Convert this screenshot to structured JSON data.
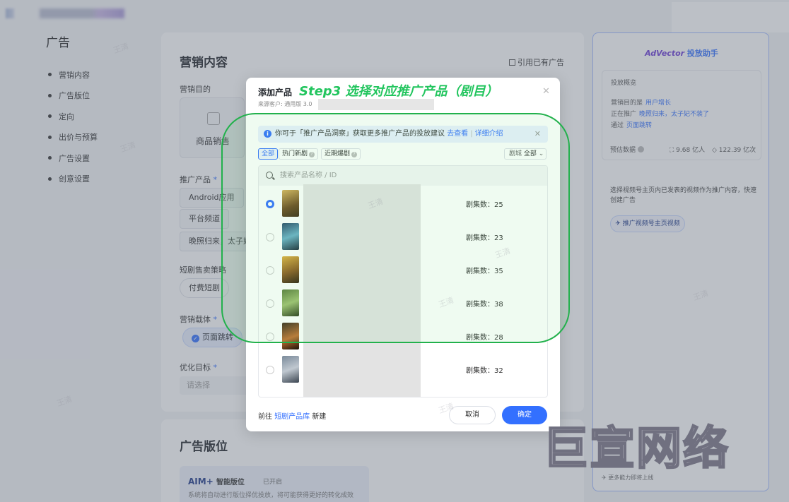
{
  "nav": {
    "title": "广告",
    "items": [
      "营销内容",
      "广告版位",
      "定向",
      "出价与预算",
      "广告设置",
      "创意设置"
    ]
  },
  "main": {
    "title": "营销内容",
    "cite_label": "引用已有广告",
    "goal_label": "营销目的",
    "goal_option": "商品销售",
    "product_label": "推广产品",
    "product_types": [
      "Android应用",
      "平台频道"
    ],
    "selected_product_text": "晚照归来，太子妃",
    "strategy_label": "短剧售卖策略",
    "strategy_option": "付费短剧",
    "carrier_label": "营销载体",
    "carrier_option": "页面跳转",
    "opt_label": "优化目标",
    "opt_placeholder": "请选择"
  },
  "position": {
    "title": "广告版位",
    "aim_brand": "AIM+",
    "aim_title": "智能版位",
    "aim_status": "已开启",
    "aim_desc": "系统将自动进行版位择优投放，将可能获得更好的转化成效"
  },
  "assistant": {
    "brand": "AdVector",
    "title": "投放助手",
    "overview": "投放概览",
    "goal_prefix": "营销目的是",
    "goal_value": "用户增长",
    "promo_prefix": "正在推广",
    "promo_value": "晚照归来，太子妃不装了",
    "via_prefix": "通过",
    "via_value": "页面跳转",
    "estimate_label": "预估数据",
    "stat_exposure": "9.68 亿人",
    "stat_clicks": "122.39 亿次",
    "tip": "选择视频号主页内已发表的视频作为推广内容，快速创建广告",
    "btn": "推广视频号主页视频",
    "more": "更多能力即将上线"
  },
  "modal": {
    "title": "添加产品",
    "annotation": "Step3 选择对应推广产品（剧目）",
    "source": "来源客户: 通用版 3.0",
    "info_text": "你可于「推广产品洞察」获取更多推广产品的投放建议",
    "info_link1": "去查看",
    "info_link2": "详细介绍",
    "filters": [
      "全部",
      "热门新剧",
      "近期爆剧"
    ],
    "theme_label": "剧城",
    "theme_value": "全部",
    "search_placeholder": "搜索产品名称 / ID",
    "rows": [
      {
        "episodes": "剧集数：25",
        "selected": true
      },
      {
        "episodes": "剧集数：23",
        "selected": false
      },
      {
        "episodes": "剧集数：35",
        "selected": false
      },
      {
        "episodes": "剧集数：38",
        "selected": false
      },
      {
        "episodes": "剧集数：28",
        "selected": false
      },
      {
        "episodes": "剧集数：32",
        "selected": false
      }
    ],
    "footer_prefix": "前往",
    "footer_link": "短剧产品库",
    "footer_suffix": "新建",
    "cancel": "取消",
    "confirm": "确定"
  },
  "watermark": {
    "small": "王清",
    "big": "巨宣网络"
  },
  "colors": {
    "accent": "#3370ff",
    "annotation_green": "#22b14c"
  }
}
